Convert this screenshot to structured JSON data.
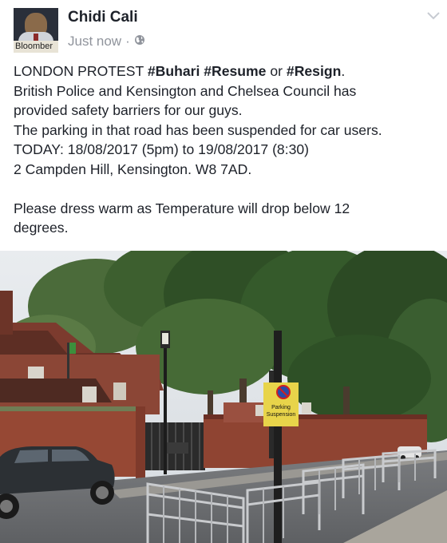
{
  "author": {
    "name": "Chidi Cali",
    "avatar_caption": "Bloomber",
    "avatar_icon": "profile-photo"
  },
  "meta": {
    "time": "Just now",
    "separator": "·",
    "privacy_icon": "globe-icon"
  },
  "menu_icon": "chevron-down-icon",
  "post": {
    "line1_prefix": "LONDON PROTEST ",
    "hashtag1": "#Buhari",
    "hashtag2": "#Resume",
    "line1_or": " or ",
    "hashtag3": "#Resign",
    "line1_end": ".",
    "line2": "British Police and Kensington and Chelsea Council has",
    "line3": "provided safety barriers for our guys.",
    "line4": "The parking in that road has been suspended for car users.",
    "line5": "TODAY: 18/08/2017 (5pm) to 19/08/2017 (8:30)",
    "line6": "2 Campden Hill, Kensington. W8 7AD.",
    "line7": "Please dress warm as Temperature will drop below 12",
    "line8": "degrees."
  },
  "photo": {
    "sign_line1": "Parking",
    "sign_line2": "Suspension"
  }
}
